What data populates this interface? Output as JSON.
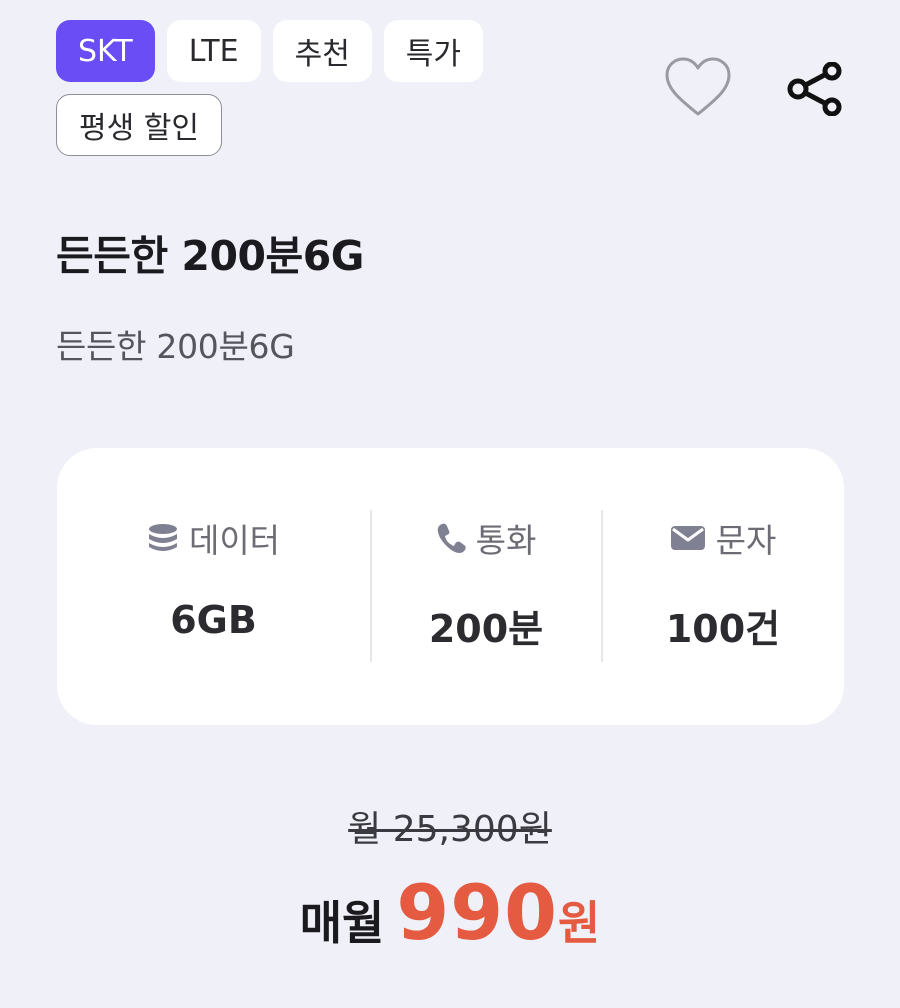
{
  "tags": {
    "row1": [
      "SKT",
      "LTE",
      "추천",
      "특가"
    ],
    "row2": [
      "평생 할인"
    ]
  },
  "icons": {
    "favorite": "heart-outline-icon",
    "share": "share-icon",
    "data": "database-icon",
    "call": "phone-icon",
    "sms": "envelope-icon"
  },
  "plan": {
    "title": "든든한 200분6G",
    "subtitle": "든든한 200분6G"
  },
  "specs": {
    "data": {
      "label": "데이터",
      "value": "6GB"
    },
    "call": {
      "label": "통화",
      "value": "200분"
    },
    "sms": {
      "label": "문자",
      "value": "100건"
    }
  },
  "price": {
    "original": "월 25,300원",
    "prefix": "매월",
    "amount": "990",
    "unit": "원"
  },
  "colors": {
    "accent": "#6a4df4",
    "price": "#e45b42",
    "background": "#f0f1f8"
  }
}
